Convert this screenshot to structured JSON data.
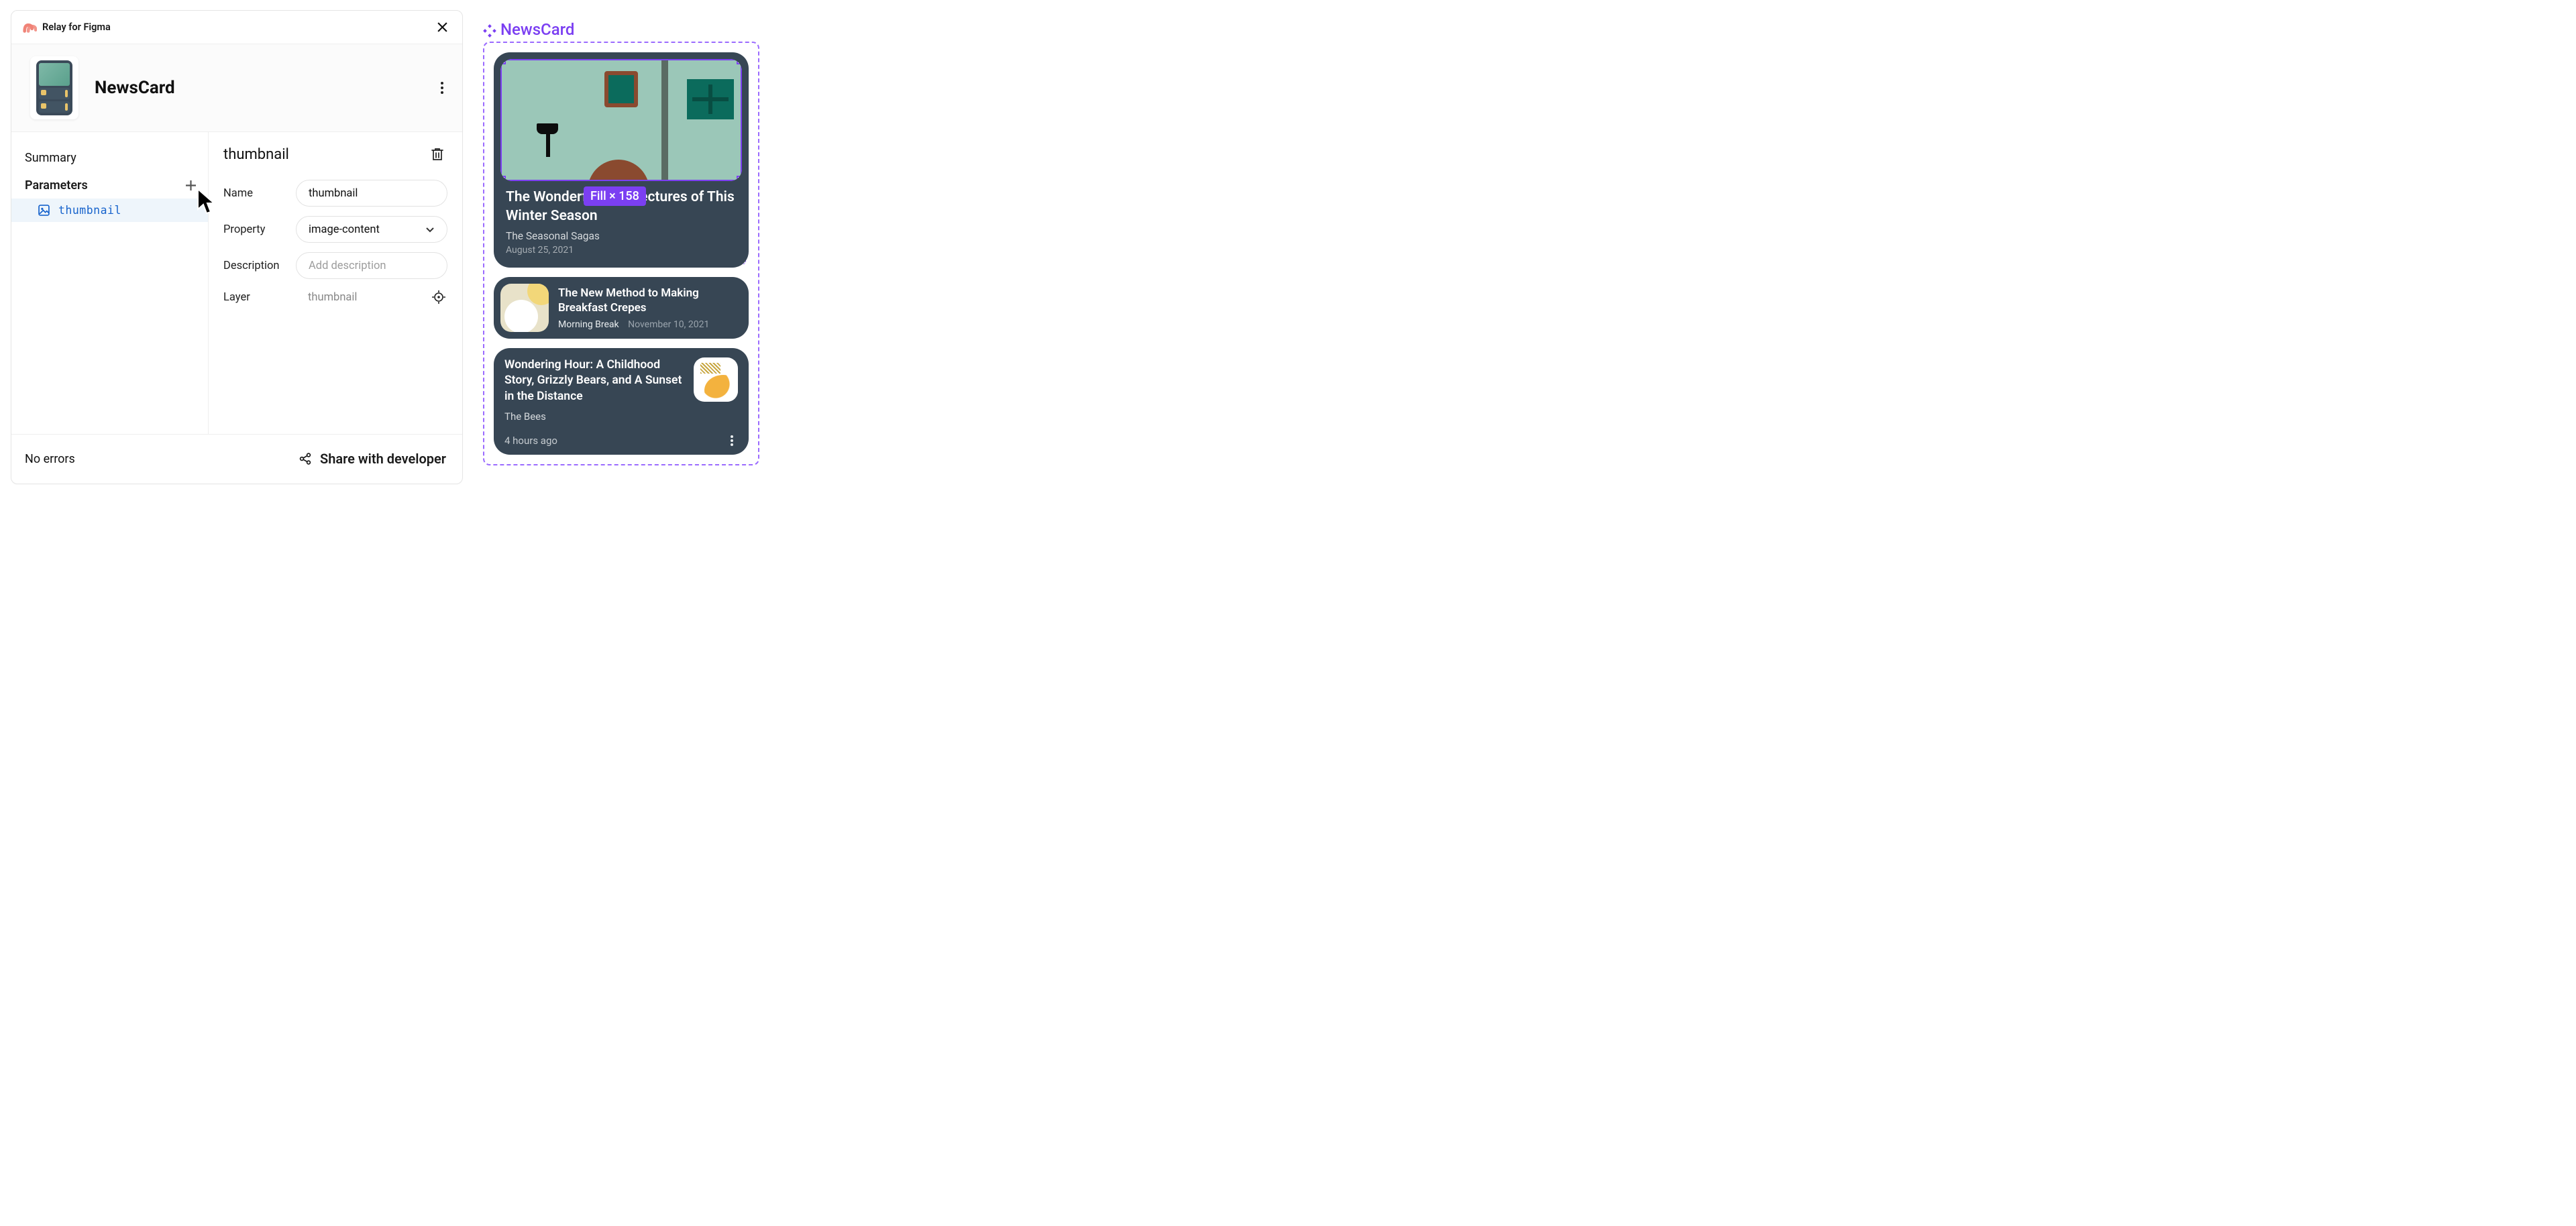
{
  "plugin": {
    "title": "Relay for Figma"
  },
  "component": {
    "name": "NewsCard"
  },
  "sidebar": {
    "summary": "Summary",
    "parameters_label": "Parameters",
    "params": [
      {
        "name": "thumbnail"
      }
    ]
  },
  "param_editor": {
    "title": "thumbnail",
    "fields": {
      "name_label": "Name",
      "name_value": "thumbnail",
      "property_label": "Property",
      "property_value": "image-content",
      "description_label": "Description",
      "description_placeholder": "Add description",
      "layer_label": "Layer",
      "layer_value": "thumbnail"
    }
  },
  "footer": {
    "errors_label": "No errors",
    "share_label": "Share with developer"
  },
  "canvas": {
    "component_label": "NewsCard",
    "selection_size": "Fill × 158",
    "cards": {
      "hero": {
        "title": "The Wonderful Architectures of This Winter Season",
        "source": "The Seasonal Sagas",
        "date": "August 25, 2021"
      },
      "row": {
        "title": "The New Method to Making Breakfast Crepes",
        "source": "Morning Break",
        "date": "November 10, 2021"
      },
      "col3": {
        "title": "Wondering Hour: A Childhood Story, Grizzly Bears, and A Sunset in the Distance",
        "source": "The Bees",
        "time": "4 hours ago"
      }
    }
  }
}
